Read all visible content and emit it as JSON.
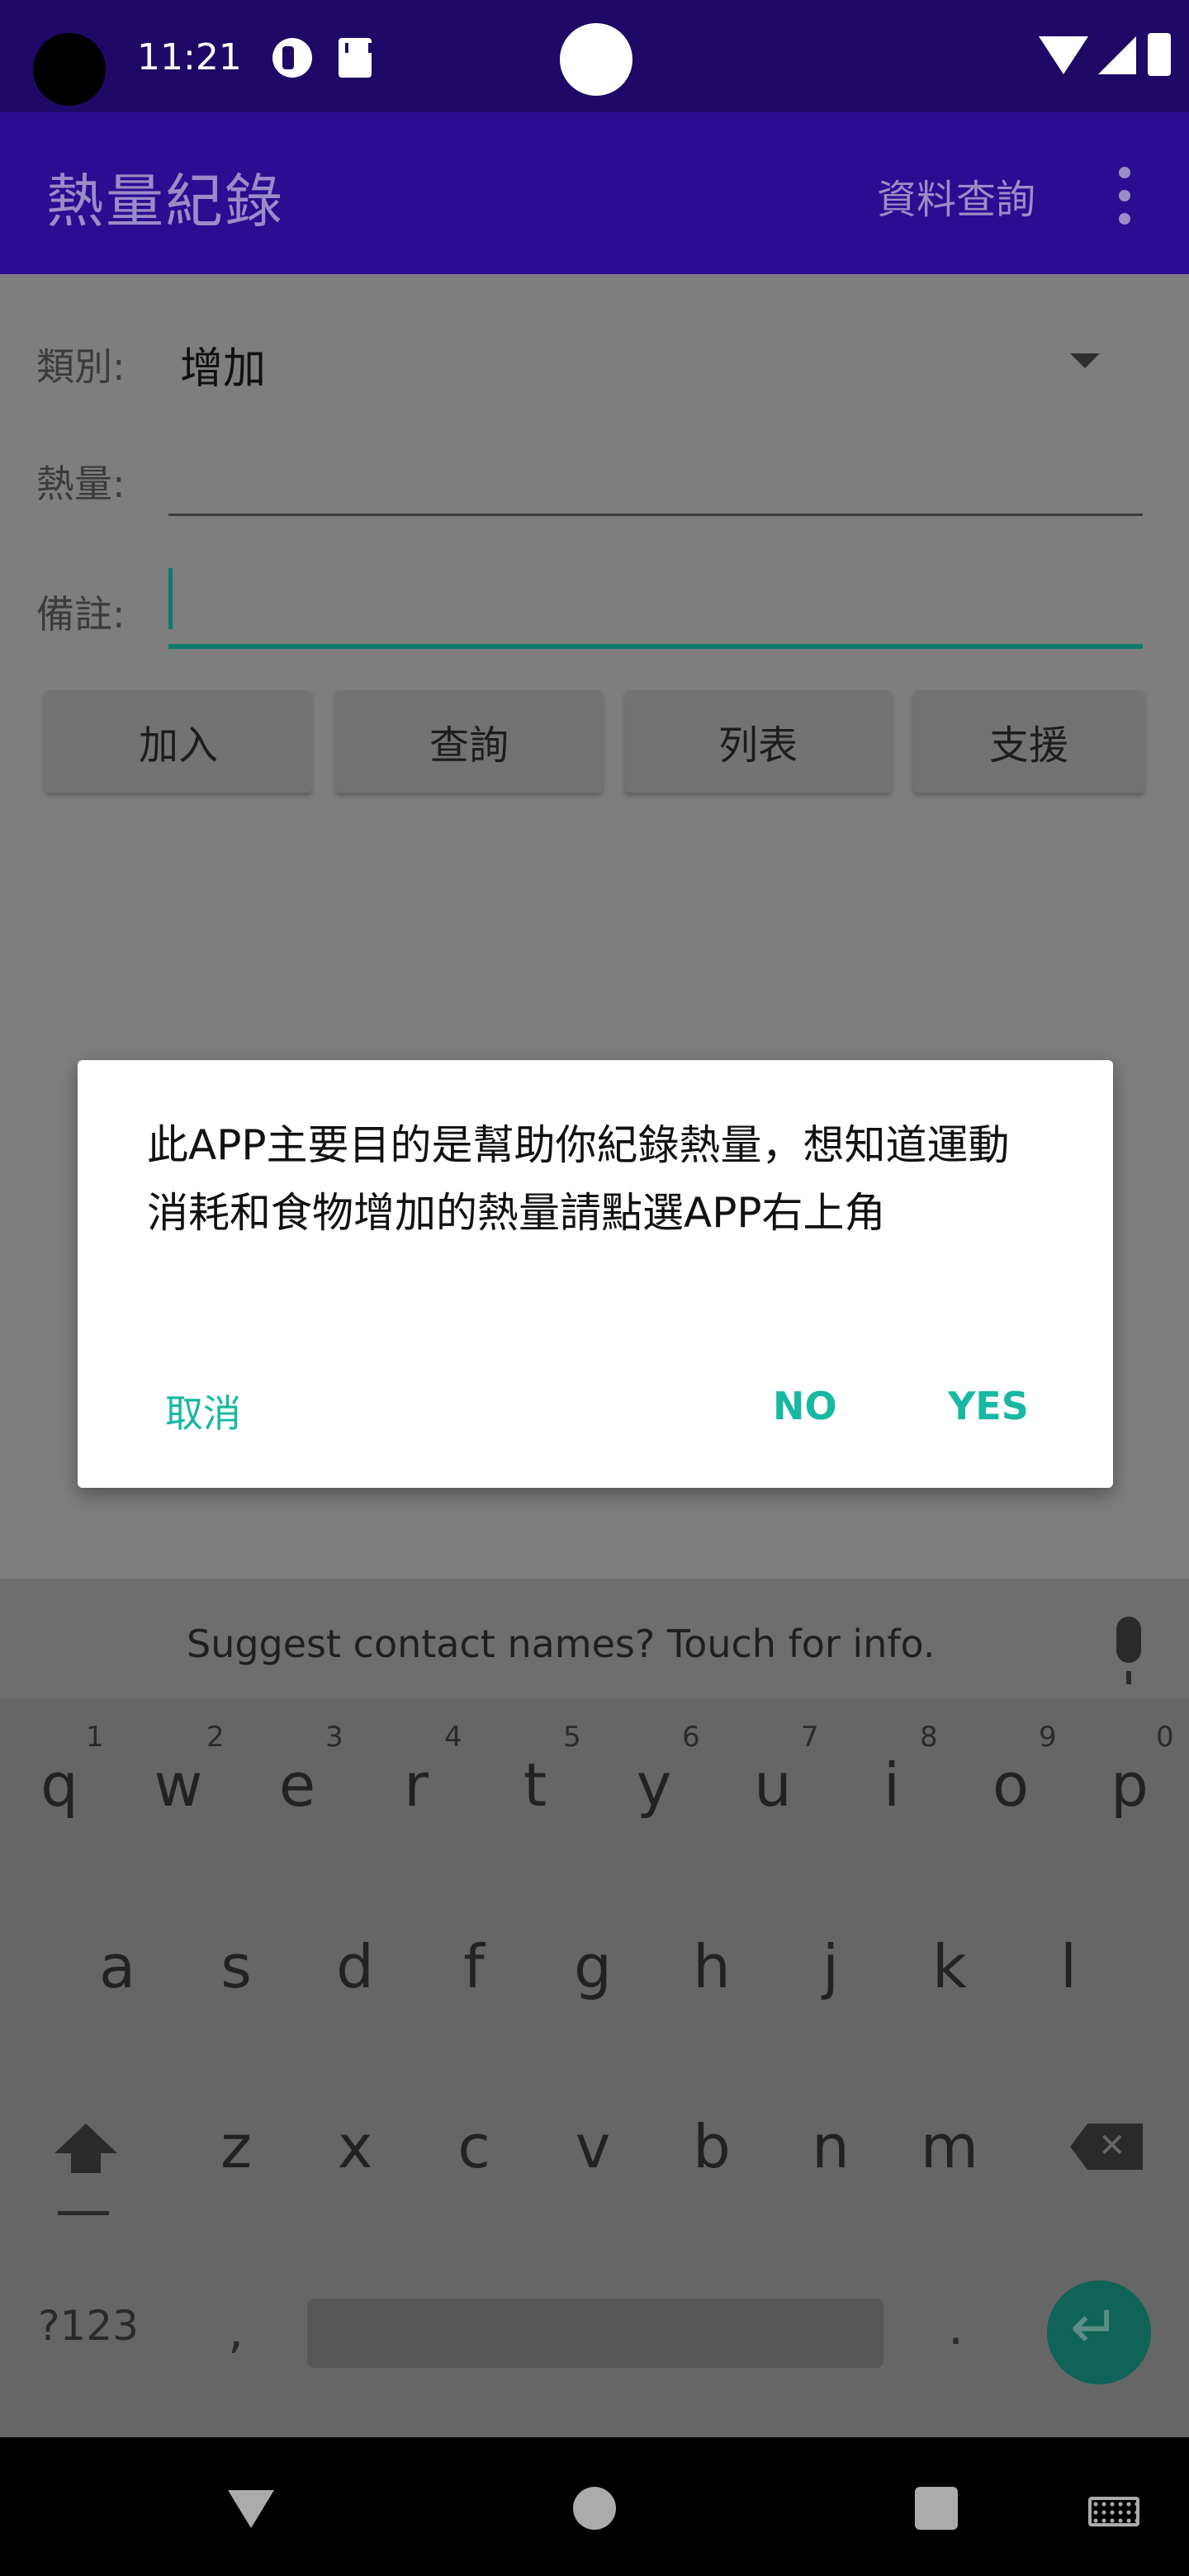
{
  "status_bar": {
    "time": "11:21"
  },
  "app_bar": {
    "title": "熱量紀錄",
    "menu_query": "資料查詢"
  },
  "form": {
    "category_label": "類別:",
    "category_value": "增加",
    "calories_label": "熱量:",
    "note_label": "備註:",
    "buttons": [
      "加入",
      "查詢",
      "列表",
      "支援"
    ]
  },
  "dialog": {
    "message": "此APP主要目的是幫助你紀錄熱量，想知道運動消耗和食物增加的熱量請點選APP右上角",
    "cancel_label": "取消",
    "no_label": "NO",
    "yes_label": "YES"
  },
  "keyboard": {
    "suggestion": "Suggest contact names? Touch for info.",
    "row1": [
      "q",
      "w",
      "e",
      "r",
      "t",
      "y",
      "u",
      "i",
      "o",
      "p"
    ],
    "row1_hints": [
      "1",
      "2",
      "3",
      "4",
      "5",
      "6",
      "7",
      "8",
      "9",
      "0"
    ],
    "row2": [
      "a",
      "s",
      "d",
      "f",
      "g",
      "h",
      "j",
      "k",
      "l"
    ],
    "row3": [
      "z",
      "x",
      "c",
      "v",
      "b",
      "n",
      "m"
    ],
    "symbols_label": "?123",
    "comma": ",",
    "period": "."
  }
}
